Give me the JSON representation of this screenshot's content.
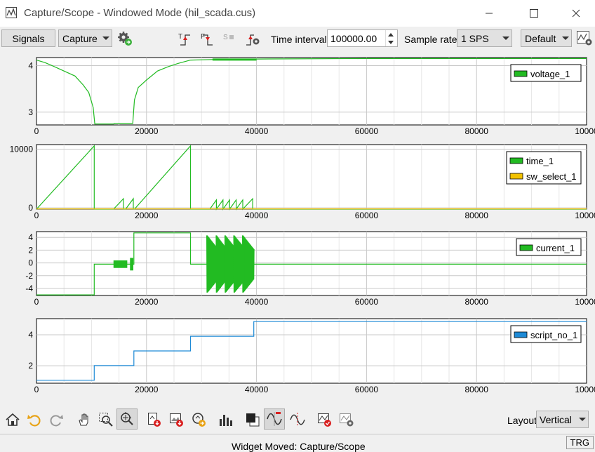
{
  "window": {
    "title": "Capture/Scope - Windowed Mode (hil_scada.cus)"
  },
  "toolbar": {
    "signals_label": "Signals",
    "mode_value": "Capture",
    "time_interval_label": "Time interval",
    "time_interval_value": "100000.00",
    "sample_rate_label": "Sample rate",
    "sample_rate_value": "1 SPS",
    "preset_value": "Default",
    "icons": [
      "settings-gear-icon",
      "trigger-rising-icon",
      "trigger-falling-icon",
      "trigger-s-icon",
      "trigger-settings-icon",
      "display-settings-icon"
    ]
  },
  "x_ticks": [
    "0",
    "20000",
    "40000",
    "60000",
    "80000",
    "10000"
  ],
  "chart_data": [
    {
      "type": "line",
      "x_range": [
        0,
        100000
      ],
      "y_ticks": [
        "4",
        "3"
      ],
      "ylim": [
        2.8,
        4.15
      ],
      "grid": true,
      "legend_placement": "top-right",
      "series": [
        {
          "name": "voltage_1",
          "color": "#22bb22",
          "x": [
            0,
            1500,
            3000,
            5000,
            7000,
            8500,
            9500,
            10300,
            10600,
            14000,
            14200,
            17500,
            17800,
            18500,
            20000,
            22000,
            24000,
            26000,
            28000,
            32000,
            36000,
            40000,
            60000,
            80000,
            100000
          ],
          "y": [
            4.1,
            4.05,
            3.98,
            3.88,
            3.78,
            3.6,
            3.45,
            3.15,
            2.82,
            2.82,
            2.83,
            2.83,
            3.3,
            3.55,
            3.7,
            3.88,
            3.97,
            4.04,
            4.1,
            4.11,
            4.11,
            4.12,
            4.13,
            4.13,
            4.13
          ]
        }
      ]
    },
    {
      "type": "line",
      "x_range": [
        0,
        100000
      ],
      "y_ticks": [
        "10000",
        "0"
      ],
      "ylim": [
        0,
        10500
      ],
      "grid": true,
      "legend_placement": "top-right",
      "series": [
        {
          "name": "time_1",
          "color": "#22bb22",
          "x": [
            0,
            10500,
            10501,
            14000,
            15800,
            15801,
            16200,
            17600,
            17601,
            17800,
            28000,
            28001,
            31500,
            32700,
            32701,
            33900,
            33901,
            35100,
            35101,
            36300,
            36301,
            37500,
            37501,
            39300,
            39301,
            100000
          ],
          "y": [
            0,
            10300,
            0,
            0,
            1700,
            0,
            0,
            1700,
            0,
            0,
            10300,
            0,
            0,
            1500,
            0,
            1500,
            0,
            1500,
            0,
            1500,
            0,
            1500,
            0,
            1700,
            0,
            0
          ]
        },
        {
          "name": "sw_select_1",
          "color": "#f2c200",
          "x": [
            0,
            100000
          ],
          "y": [
            50,
            50
          ]
        }
      ]
    },
    {
      "type": "line",
      "x_range": [
        0,
        100000
      ],
      "y_ticks": [
        "4",
        "2",
        "0",
        "-2",
        "-4"
      ],
      "ylim": [
        -5,
        5.2
      ],
      "grid": true,
      "legend_placement": "top-right",
      "series": [
        {
          "name": "current_1",
          "color": "#22bb22",
          "x": [
            0,
            10500,
            10501,
            17700,
            17701,
            28000,
            28001,
            31000,
            39500,
            100000
          ],
          "y": [
            -4.9,
            -4.9,
            0,
            0,
            5,
            5,
            0,
            0,
            0,
            0
          ]
        }
      ]
    },
    {
      "type": "line",
      "x_range": [
        0,
        100000
      ],
      "y_ticks": [
        "4",
        "2"
      ],
      "ylim": [
        0.8,
        5.2
      ],
      "grid": true,
      "legend_placement": "top-right",
      "series": [
        {
          "name": "script_no_1",
          "color": "#1e8ad6",
          "x": [
            0,
            10500,
            10501,
            17700,
            17701,
            28000,
            28001,
            39500,
            39501,
            100000
          ],
          "y": [
            1,
            1,
            2,
            2,
            3,
            3,
            4,
            4,
            5,
            5
          ]
        }
      ]
    }
  ],
  "bottom": {
    "layout_label": "Layout",
    "layout_value": "Vertical",
    "icons": [
      "home-icon",
      "undo-icon",
      "redo-icon",
      "pan-hand-icon",
      "zoom-area-icon",
      "zoom-move-icon",
      "export-csv-icon",
      "export-image-icon",
      "export-settings-icon",
      "bar-chart-icon",
      "cursor-square-icon",
      "sine-wave-icon",
      "sine-cursor-icon",
      "stop-capture-icon",
      "capture-settings-icon"
    ]
  },
  "status": {
    "trg_label": "TRG",
    "background_text": "Widget Moved: Capture/Scope"
  },
  "colors": {
    "accent": "#22bb22",
    "script": "#1e8ad6",
    "sw": "#f2c200"
  }
}
